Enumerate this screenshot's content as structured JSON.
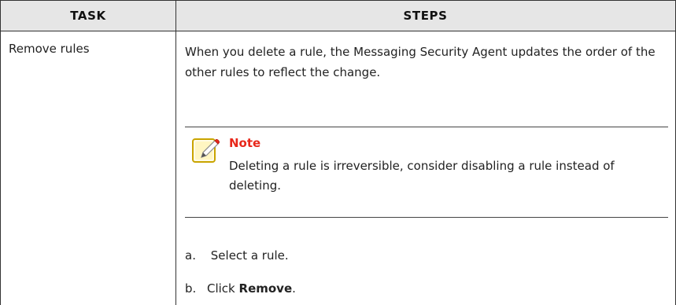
{
  "header": {
    "task": "Task",
    "steps": "Steps"
  },
  "row": {
    "task": "Remove rules",
    "intro": "When you delete a rule, the Messaging Security Agent updates the order of the other rules to reflect the change.",
    "note": {
      "title": "Note",
      "body": "Deleting a rule is irreversible, consider disabling a rule instead of deleting.",
      "icon": "note-pencil-icon"
    },
    "steps": [
      {
        "letter": "a.",
        "text": "Select a rule."
      },
      {
        "letter": "b.",
        "prefix": "Click ",
        "bold": "Remove",
        "suffix": "."
      }
    ]
  }
}
